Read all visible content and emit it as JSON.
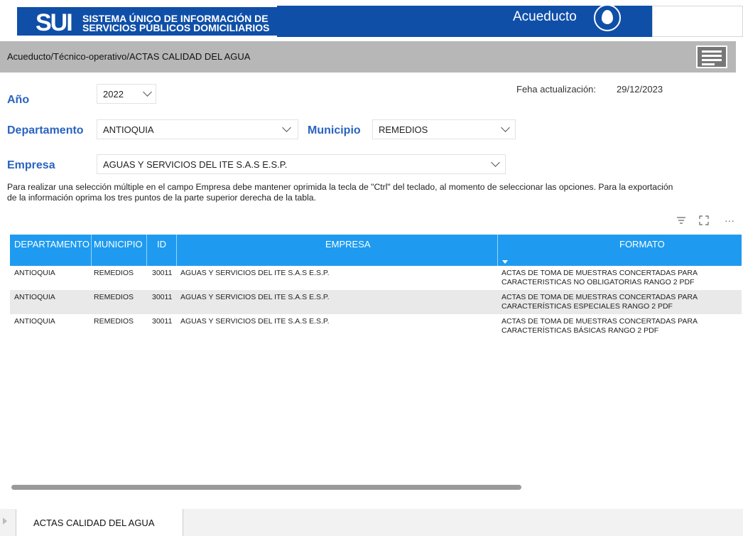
{
  "header": {
    "logo_mark": "SUI",
    "logo_line1": "SISTEMA ÚNICO DE INFORMACIÓN DE",
    "logo_line2": "SERVICIOS PÚBLICOS DOMICILIARIOS",
    "service": "Acueducto",
    "brand_color": "#0f4fa8"
  },
  "breadcrumb": "Acueducto/Técnico-operativo/ACTAS CALIDAD DEL AGUA",
  "filters": {
    "year_label": "Año",
    "year_value": "2022",
    "department_label": "Departamento",
    "department_value": "ANTIOQUIA",
    "municipality_label": "Municipio",
    "municipality_value": "REMEDIOS",
    "company_label": "Empresa",
    "company_value": "AGUAS Y SERVICIOS DEL ITE S.A.S E.S.P."
  },
  "update": {
    "label": "Feha actualización:",
    "value": "29/12/2023"
  },
  "note_line1": "Para realizar una selección múltiple en el campo Empresa debe mantener oprimida la tecla de \"Ctrl\" del teclado, al momento de seleccionar las opciones. Para la exportación",
  "note_line2": "de la información oprima los tres puntos de la parte superior derecha de la tabla.",
  "toolbar": {
    "filter_icon": "filter-icon",
    "focus_icon": "focus-mode-icon",
    "more_icon": "more-options-icon",
    "more_glyph": "···"
  },
  "table": {
    "header_color": "#1e9bf0",
    "columns": [
      "DEPARTAMENTO",
      "MUNICIPIO",
      "ID",
      "EMPRESA",
      "FORMATO"
    ],
    "rows": [
      {
        "departamento": "ANTIOQUIA",
        "municipio": "REMEDIOS",
        "id": "30011",
        "empresa": "AGUAS Y SERVICIOS DEL ITE S.A.S E.S.P.",
        "formato_1": "ACTAS DE TOMA DE MUESTRAS CONCERTADAS PARA",
        "formato_2": "CARACTERISTICAS NO OBLIGATORIAS RANGO 2 PDF"
      },
      {
        "departamento": "ANTIOQUIA",
        "municipio": "REMEDIOS",
        "id": "30011",
        "empresa": "AGUAS Y SERVICIOS DEL ITE S.A.S E.S.P.",
        "formato_1": "ACTAS DE TOMA DE MUESTRAS CONCERTADAS PARA",
        "formato_2": "CARACTERÍSTICAS ESPECIALES RANGO 2 PDF"
      },
      {
        "departamento": "ANTIOQUIA",
        "municipio": "REMEDIOS",
        "id": "30011",
        "empresa": "AGUAS Y SERVICIOS DEL ITE S.A.S E.S.P.",
        "formato_1": "ACTAS DE TOMA DE MUESTRAS CONCERTADAS PARA",
        "formato_2": "CARACTERÍSTICAS BÁSICAS RANGO 2 PDF"
      }
    ]
  },
  "tabs": {
    "active": "ACTAS CALIDAD DEL AGUA"
  }
}
